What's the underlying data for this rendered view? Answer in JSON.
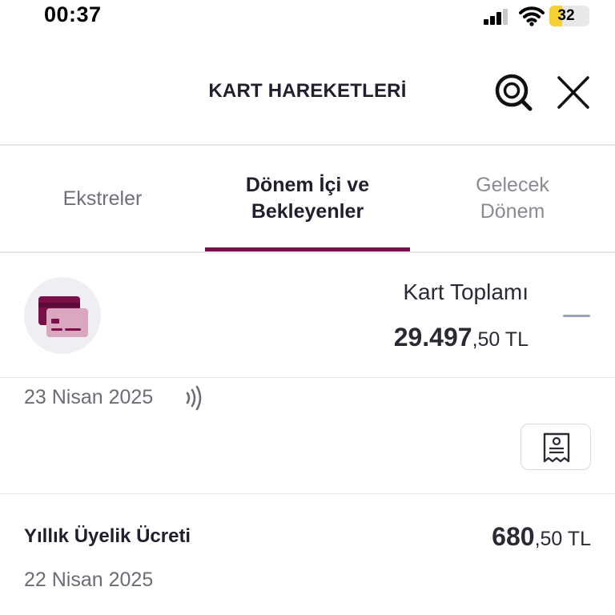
{
  "status_bar": {
    "time": "00:37",
    "battery_level": "32",
    "battery_percent": 32,
    "battery_color": "#f6d134"
  },
  "header": {
    "title": "KART HAREKETLERİ",
    "search_icon": "search-icon",
    "close_icon": "close-icon"
  },
  "tabs": [
    {
      "label": "Ekstreler",
      "active": false
    },
    {
      "label": "Dönem İçi ve Bekleyenler",
      "active": true
    },
    {
      "label": "Gelecek Dönem",
      "active": false
    }
  ],
  "accent_color": "#7a0f4a",
  "card_summary": {
    "icon": "credit-card-icon",
    "label": "Kart Toplamı",
    "amount_integer": "29.497",
    "amount_decimal": ",50 TL",
    "toggle_icon": "collapse-icon"
  },
  "transactions": [
    {
      "date": "23 Nisan 2025",
      "icon": "contactless-icon",
      "action_icon": "receipt-icon"
    },
    {
      "title": "Yıllık Üyelik Ücreti",
      "amount_integer": "680",
      "amount_decimal": ",50 TL",
      "date": "22 Nisan 2025"
    }
  ]
}
